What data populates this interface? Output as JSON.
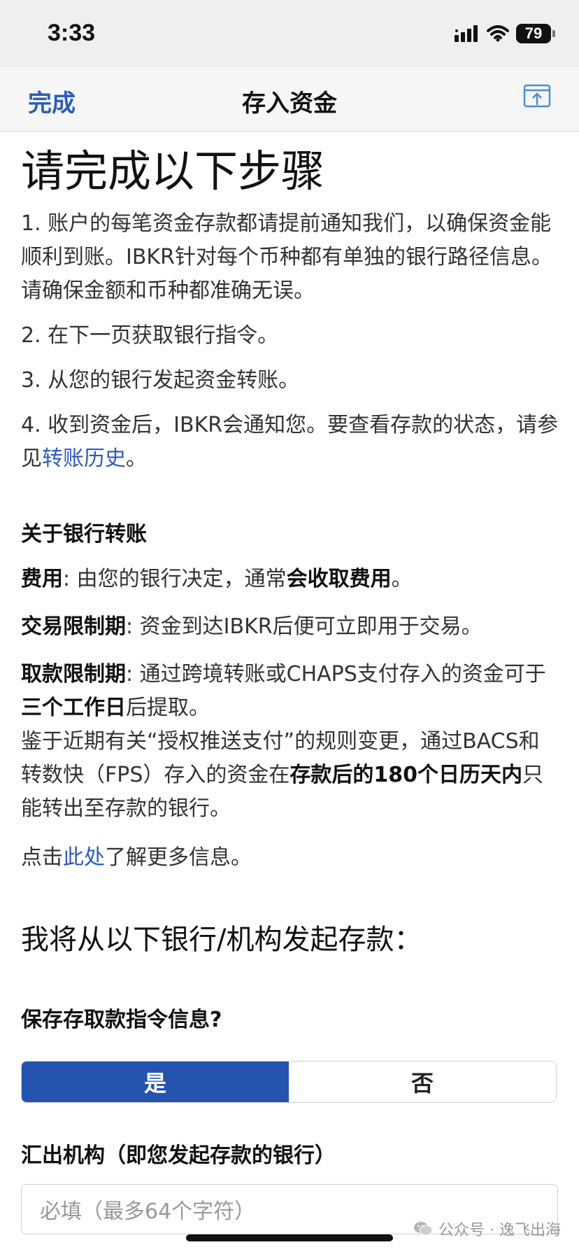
{
  "status_bar": {
    "time": "3:33",
    "battery": "79"
  },
  "nav": {
    "done_label": "完成",
    "title": "存入资金"
  },
  "heading": "请完成以下步骤",
  "steps": {
    "s1": "1. 账户的每笔资金存款都请提前通知我们，以确保资金能顺利到账。IBKR针对每个币种都有单独的银行路径信息。请确保金额和币种都准确无误。",
    "s2": "2. 在下一页获取银行指令。",
    "s3": "3. 从您的银行发起资金转账。",
    "s4_prefix": "4. 收到资金后，IBKR会通知您。要查看存款的状态，请参见",
    "s4_link": "转账历史",
    "s4_suffix": "。"
  },
  "about": {
    "title": "关于银行转账",
    "fees_label": "费用",
    "fees_text": ": 由您的银行决定，通常",
    "fees_bold": "会收取费用",
    "fees_end": "。",
    "trade_label": "交易限制期",
    "trade_text": ": 资金到达IBKR后便可立即用于交易。",
    "withdraw_label": "取款限制期",
    "withdraw_text": ": 通过跨境转账或CHAPS支付存入的资金可于",
    "withdraw_bold": "三个工作日",
    "withdraw_end": "后提取。",
    "bacs_text": "鉴于近期有关“授权推送支付”的规则变更，通过BACS和转数快（FPS）存入的资金在",
    "bacs_bold": "存款后的180个日历天内",
    "bacs_end": "只能转出至存款的银行。",
    "click_prefix": "点击",
    "click_link": "此处",
    "click_suffix": "了解更多信息。"
  },
  "bank_heading": "我将从以下银行/机构发起存款：",
  "save_question": "保存存取款指令信息?",
  "toggle": {
    "yes": "是",
    "no": "否"
  },
  "institution": {
    "label": "汇出机构（即您发起存款的银行）",
    "placeholder": "必填（最多64个字符）"
  },
  "watermark": "公众号 · 逸飞出海",
  "colors": {
    "accent": "#2b5cb8",
    "toggle_selected": "#2453b0"
  },
  "icons": [
    "signal-icon",
    "wifi-icon",
    "battery-icon",
    "share-icon",
    "wechat-icon"
  ]
}
